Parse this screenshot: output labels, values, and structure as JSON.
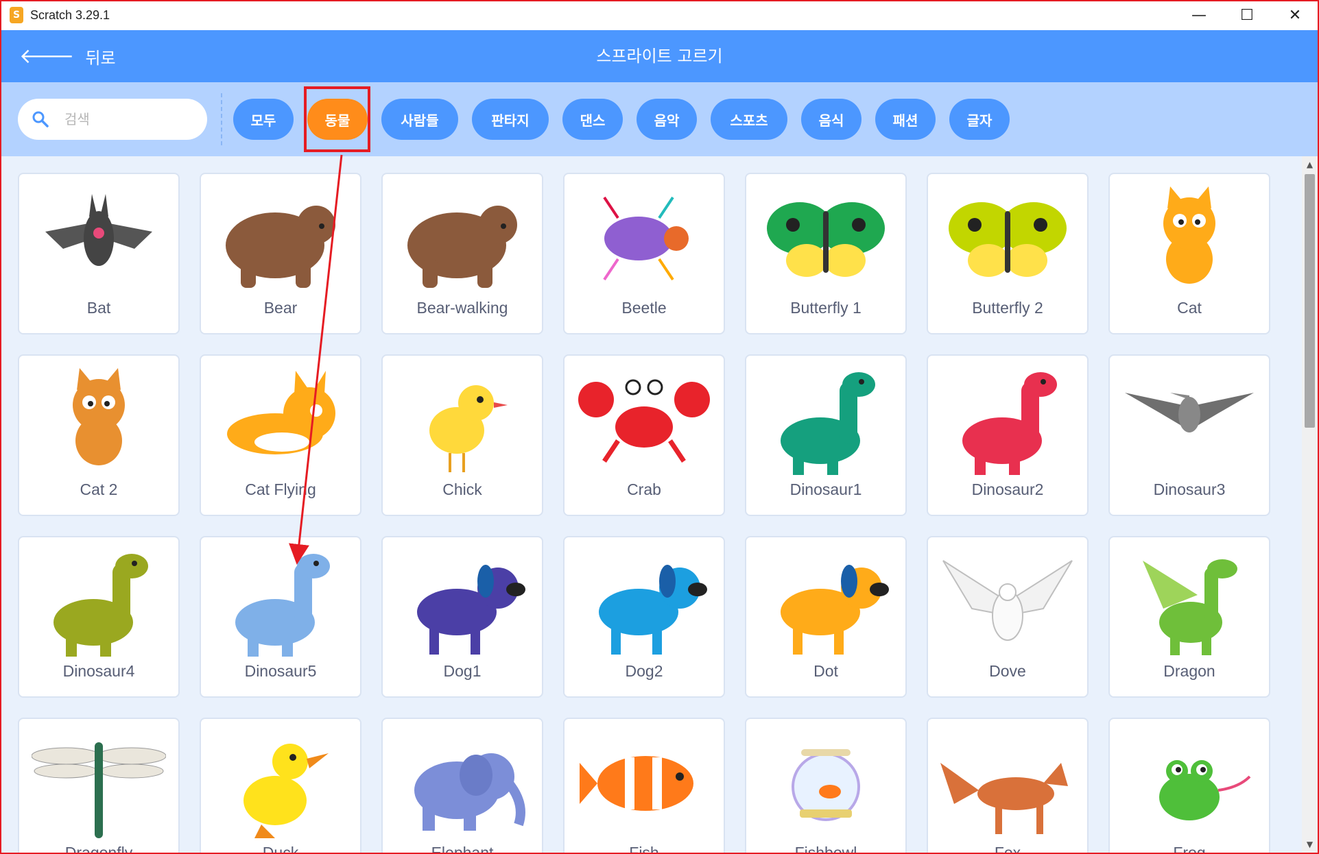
{
  "titlebar": {
    "app_title": "Scratch 3.29.1",
    "app_icon_glyph": "S",
    "minimize": "—",
    "maximize": "☐",
    "close": "✕"
  },
  "header": {
    "back_label": "뒤로",
    "title": "스프라이트 고르기"
  },
  "search": {
    "placeholder": "검색",
    "value": ""
  },
  "tags": [
    {
      "label": "모두",
      "active": false
    },
    {
      "label": "동물",
      "active": true
    },
    {
      "label": "사람들",
      "active": false
    },
    {
      "label": "판타지",
      "active": false
    },
    {
      "label": "댄스",
      "active": false
    },
    {
      "label": "음악",
      "active": false
    },
    {
      "label": "스포츠",
      "active": false
    },
    {
      "label": "음식",
      "active": false
    },
    {
      "label": "패션",
      "active": false
    },
    {
      "label": "글자",
      "active": false
    }
  ],
  "sprites": [
    {
      "name": "Bat",
      "icon": "bat-icon",
      "color": "#555555"
    },
    {
      "name": "Bear",
      "icon": "bear-icon",
      "color": "#8b5a3c"
    },
    {
      "name": "Bear-walking",
      "icon": "bear-walking-icon",
      "color": "#8b5a3c"
    },
    {
      "name": "Beetle",
      "icon": "beetle-icon",
      "color": "#8f5fd1"
    },
    {
      "name": "Butterfly 1",
      "icon": "butterfly-icon",
      "color": "#1fa850"
    },
    {
      "name": "Butterfly 2",
      "icon": "butterfly-icon",
      "color": "#c2d600"
    },
    {
      "name": "Cat",
      "icon": "cat-icon",
      "color": "#ffab19"
    },
    {
      "name": "Cat 2",
      "icon": "cat-icon",
      "color": "#e89030"
    },
    {
      "name": "Cat Flying",
      "icon": "cat-flying-icon",
      "color": "#ffab19"
    },
    {
      "name": "Chick",
      "icon": "chick-icon",
      "color": "#ffd93b"
    },
    {
      "name": "Crab",
      "icon": "crab-icon",
      "color": "#e8232b"
    },
    {
      "name": "Dinosaur1",
      "icon": "dinosaur-icon",
      "color": "#15a07e"
    },
    {
      "name": "Dinosaur2",
      "icon": "dinosaur-icon",
      "color": "#e8304f"
    },
    {
      "name": "Dinosaur3",
      "icon": "pterosaur-icon",
      "color": "#6f6f6f"
    },
    {
      "name": "Dinosaur4",
      "icon": "dinosaur-icon",
      "color": "#9aa820"
    },
    {
      "name": "Dinosaur5",
      "icon": "dinosaur-icon",
      "color": "#7fb0e8"
    },
    {
      "name": "Dog1",
      "icon": "dog-icon",
      "color": "#4b3fa6"
    },
    {
      "name": "Dog2",
      "icon": "dog-icon",
      "color": "#1c9fe0"
    },
    {
      "name": "Dot",
      "icon": "dog-icon",
      "color": "#ffab19"
    },
    {
      "name": "Dove",
      "icon": "dove-icon",
      "color": "#bfbfbf"
    },
    {
      "name": "Dragon",
      "icon": "dragon-icon",
      "color": "#6fbf3a"
    },
    {
      "name": "Dragonfly",
      "icon": "dragonfly-icon",
      "color": "#2c6f4f"
    },
    {
      "name": "Duck",
      "icon": "duck-icon",
      "color": "#ffe21c"
    },
    {
      "name": "Elephant",
      "icon": "elephant-icon",
      "color": "#7c8ed8"
    },
    {
      "name": "Fish",
      "icon": "fish-icon",
      "color": "#ff7a1a"
    },
    {
      "name": "Fishbowl",
      "icon": "fishbowl-icon",
      "color": "#b8a8e8"
    },
    {
      "name": "Fox",
      "icon": "fox-icon",
      "color": "#d9713a"
    },
    {
      "name": "Frog",
      "icon": "frog-icon",
      "color": "#4fbf3a"
    }
  ],
  "colors": {
    "accent": "#4c97ff",
    "active_tag": "#ff8c1a",
    "highlight": "#e51c23"
  }
}
